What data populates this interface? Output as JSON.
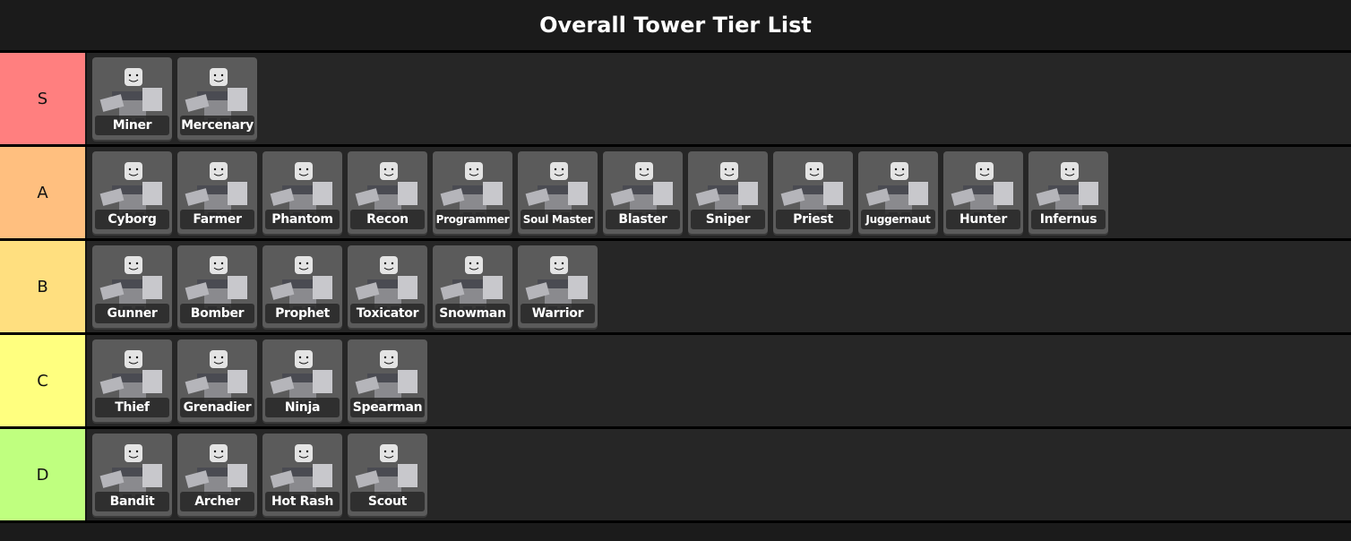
{
  "title": "Overall Tower Tier List",
  "tiers": [
    {
      "label": "S",
      "color": "#ff7f7f",
      "towers": [
        "Miner",
        "Mercenary"
      ]
    },
    {
      "label": "A",
      "color": "#ffbf7f",
      "towers": [
        "Cyborg",
        "Farmer",
        "Phantom",
        "Recon",
        "Programmer",
        "Soul Master",
        "Blaster",
        "Sniper",
        "Priest",
        "Juggernaut",
        "Hunter",
        "Infernus"
      ]
    },
    {
      "label": "B",
      "color": "#ffdf7f",
      "towers": [
        "Gunner",
        "Bomber",
        "Prophet",
        "Toxicator",
        "Snowman",
        "Warrior"
      ]
    },
    {
      "label": "C",
      "color": "#ffff7f",
      "towers": [
        "Thief",
        "Grenadier",
        "Ninja",
        "Spearman"
      ]
    },
    {
      "label": "D",
      "color": "#bfff7f",
      "towers": [
        "Bandit",
        "Archer",
        "Hot Rash",
        "Scout"
      ]
    }
  ]
}
